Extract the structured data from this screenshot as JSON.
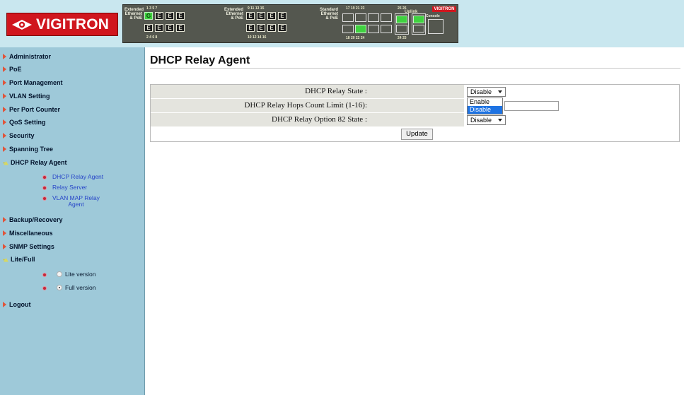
{
  "header": {
    "brand": "VIGITRON",
    "panel": {
      "groups": [
        {
          "label_lines": [
            "Extended",
            "Ethernet",
            "& PoE"
          ],
          "top_nums": "1  3  5  7",
          "bottom_nums": "2  4  6  8"
        },
        {
          "label_lines": [
            "Extended",
            "Ethernet",
            "& PoE"
          ],
          "top_nums": "9  11  13  15",
          "bottom_nums": "10  12  14  16"
        },
        {
          "label_lines": [
            "Standard",
            "Ethernet",
            "& PoE"
          ],
          "top_nums": "17  19  21  23",
          "bottom_nums": "18  20  22  24"
        }
      ],
      "uplink_label": "Uplink",
      "uplink_nums_top": "25  26",
      "uplink_nums_bottom": "24  25",
      "console_label": "Console",
      "logo_text": "VIGITRON",
      "port_letters": {
        "g": "G",
        "e": "E"
      },
      "active_color": "#3fd23f"
    }
  },
  "sidebar": {
    "items": [
      {
        "label": "Administrator"
      },
      {
        "label": "PoE"
      },
      {
        "label": "Port Management"
      },
      {
        "label": "VLAN Setting"
      },
      {
        "label": "Per Port Counter"
      },
      {
        "label": "QoS Setting"
      },
      {
        "label": "Security"
      },
      {
        "label": "Spanning Tree"
      },
      {
        "label": "DHCP Relay Agent"
      },
      {
        "label": "Backup/Recovery"
      },
      {
        "label": "Miscellaneous"
      },
      {
        "label": "SNMP Settings"
      },
      {
        "label": "Lite/Full"
      },
      {
        "label": "Logout"
      }
    ],
    "dhcp_sub": [
      {
        "label": "DHCP Relay Agent"
      },
      {
        "label": "Relay Server"
      },
      {
        "label": "VLAN MAP Relay Agent",
        "line1": "VLAN MAP Relay",
        "line2": "Agent"
      }
    ],
    "version_options": [
      {
        "label": "Lite version",
        "checked": false
      },
      {
        "label": "Full version",
        "checked": true
      }
    ],
    "colors": {
      "background": "#9ec9d9",
      "sub_link": "#2745c8",
      "arrow": "#e0543a"
    }
  },
  "main": {
    "title": "DHCP Relay Agent",
    "rows": [
      {
        "label": "DHCP Relay State :",
        "value": "Disable"
      },
      {
        "label": "DHCP Relay Hops Count Limit (1-16):",
        "value": ""
      },
      {
        "label": "DHCP Relay Option 82 State :",
        "value": "Disable"
      }
    ],
    "update_label": "Update",
    "dropdown_options": [
      "Enable",
      "Disable"
    ],
    "dropdown_selected": "Disable"
  }
}
